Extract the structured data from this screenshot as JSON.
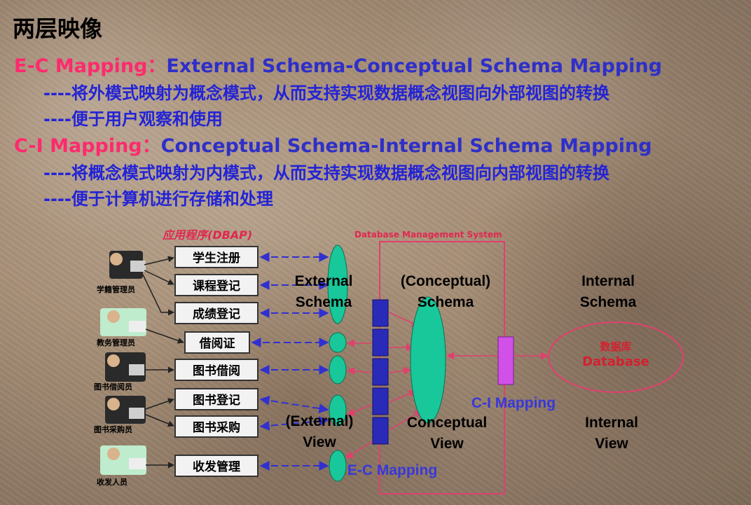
{
  "headline": "两层映像",
  "ec": {
    "key": "E-C Mapping：",
    "title": "External Schema-Conceptual Schema Mapping",
    "line1": "----将外模式映射为概念模式，从而支持实现数据概念视图向外部视图的转换",
    "line2": "----便于用户观察和使用"
  },
  "ci": {
    "key": "C-I Mapping：",
    "title": "Conceptual Schema-Internal Schema Mapping",
    "line1": "----将概念模式映射为内模式，从而支持实现数据概念视图向内部视图的转换",
    "line2": "----便于计算机进行存储和处理"
  },
  "diagram": {
    "app_group_label": "应用程序(DBAP)",
    "dbms_label": "Database Management System",
    "apps": [
      "学生注册",
      "课程登记",
      "成绩登记",
      "借阅证",
      "图书借阅",
      "图书登记",
      "图书采购",
      "收发管理"
    ],
    "users": [
      "学籍管理员",
      "教务管理员",
      "图书借阅员",
      "图书采购员",
      "收发人员"
    ],
    "external_schema": [
      "External",
      "Schema"
    ],
    "conceptual_schema": [
      "(Conceptual)",
      "Schema"
    ],
    "internal_schema": [
      "Internal",
      "Schema"
    ],
    "external_view": [
      "(External)",
      "View"
    ],
    "conceptual_view": [
      "Conceptual",
      "View"
    ],
    "internal_view": [
      "Internal",
      "View"
    ],
    "ci_mapping": "C-I Mapping",
    "ec_mapping": "E-C Mapping",
    "database_cn": "数据库",
    "database_en": "Database"
  },
  "colors": {
    "pink": "#ff2a6d",
    "blue": "#2f2fc8",
    "green": "#18c89a",
    "navy_block": "#2a2ab8",
    "violet": "#d050e8",
    "dbms_border": "#e0406e"
  }
}
